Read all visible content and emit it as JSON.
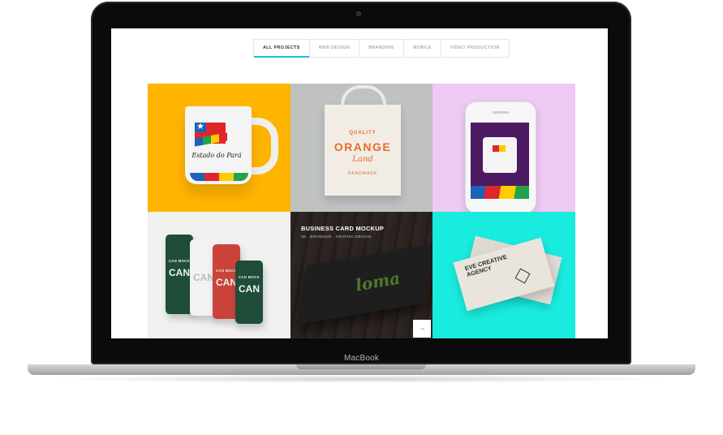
{
  "device": {
    "brand_label": "MacBook"
  },
  "filters": {
    "tabs": [
      {
        "label": "ALL PROJECTS",
        "active": true
      },
      {
        "label": "WEB DESIGN",
        "active": false
      },
      {
        "label": "BRANDING",
        "active": false
      },
      {
        "label": "MOBILE",
        "active": false
      },
      {
        "label": "VIDEO PRODUCTION",
        "active": false
      }
    ]
  },
  "portfolio": {
    "items": [
      {
        "kind": "mug",
        "bg": "#ffb400",
        "mug_text": "Estado do Pará"
      },
      {
        "kind": "tote-bag",
        "bg": "#bfc2c1",
        "line1": "QUALITY",
        "line2": "ORANGE",
        "line3": "Land",
        "line4": "HANDMADE"
      },
      {
        "kind": "phone",
        "bg": "#eecaf5"
      },
      {
        "kind": "cans",
        "bg": "#f0f0ef",
        "can_small": "CAN MOCK",
        "can_big": "CAN"
      },
      {
        "kind": "business-card",
        "bg": "#2a221e",
        "title": "BUSINESS CARD MOCKUP",
        "subtitle": "3D . BRANDING . GRAPHIC DESIGN",
        "logo": "loma"
      },
      {
        "kind": "agency-card",
        "bg": "#19ecde",
        "text": "EVE CREATIVE AGENCY"
      }
    ]
  },
  "colors": {
    "accent": "#18c2d9"
  },
  "icons": {
    "next": "arrow-right-icon",
    "camera": "camera-icon"
  }
}
